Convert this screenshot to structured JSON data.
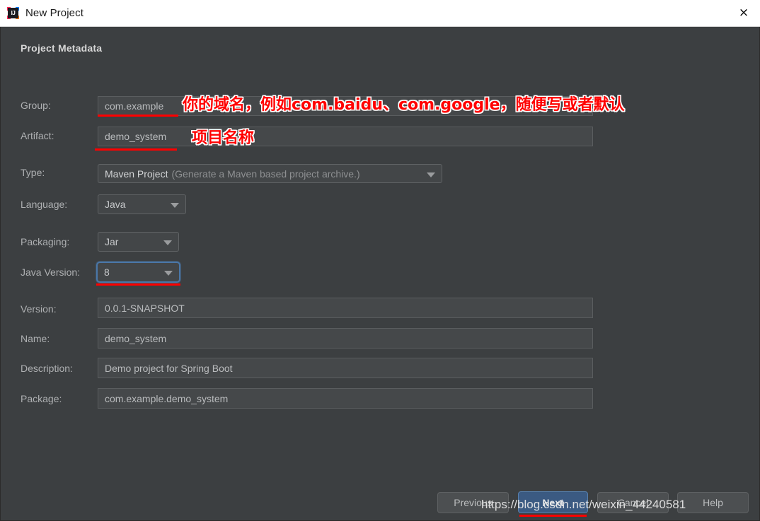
{
  "window": {
    "title": "New Project",
    "app_icon": "intellij-idea-icon",
    "icon_letters": "IJ",
    "close_icon": "×"
  },
  "section": {
    "heading": "Project Metadata"
  },
  "fields": {
    "group": {
      "label": "Group:",
      "value": "com.example"
    },
    "artifact": {
      "label": "Artifact:",
      "value": "demo_system"
    },
    "type": {
      "label": "Type:",
      "value_main": "Maven Project",
      "value_hint": "(Generate a Maven based project archive.)"
    },
    "language": {
      "label": "Language:",
      "value": "Java"
    },
    "packaging": {
      "label": "Packaging:",
      "value": "Jar"
    },
    "java_version": {
      "label": "Java Version:",
      "value": "8"
    },
    "version": {
      "label": "Version:",
      "value": "0.0.1-SNAPSHOT"
    },
    "name": {
      "label": "Name:",
      "value": "demo_system"
    },
    "description": {
      "label": "Description:",
      "value": "Demo project for Spring Boot"
    },
    "package": {
      "label": "Package:",
      "value": "com.example.demo_system"
    }
  },
  "annotations": {
    "group_note": "你的域名，例如com.baidu、com.google，随便写或者默认",
    "artifact_note": "项目名称",
    "highlight_color": "#ff0000"
  },
  "buttons": {
    "previous": "Previous",
    "next": "Next",
    "cancel": "Cancel",
    "help": "Help"
  },
  "watermark": {
    "text": "https://blog.csdn.net/weixin_44240581"
  },
  "colors": {
    "dialog_background": "#3c3f41",
    "titlebar_background": "#ffffff",
    "field_background": "#45484a",
    "focus_ring": "#4a77a8",
    "primary_button": "#3b5a82",
    "annotation_red": "#ff0000"
  }
}
